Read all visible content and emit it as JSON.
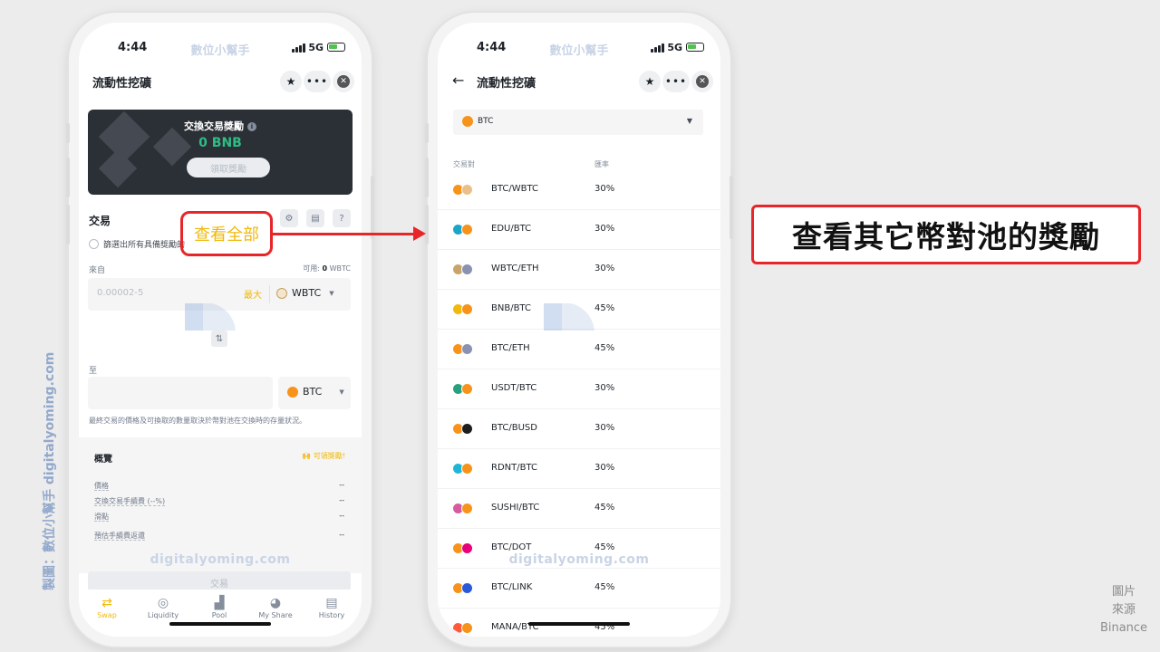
{
  "status": {
    "time": "4:44",
    "watermark": "數位小幫手",
    "network": "5G"
  },
  "left": {
    "nav_title": "流動性挖礦",
    "banner": {
      "title": "交換交易獎勵",
      "amount": "0 BNB",
      "claim": "領取獎勵"
    },
    "section_title": "交易",
    "radio_label": "篩選出所有具備獎勵的",
    "from_label": "來自",
    "available_prefix": "可用:",
    "available_value": "0",
    "available_unit": "WBTC",
    "from_placeholder": "0.00002-5",
    "max_label": "最大",
    "from_token": "WBTC",
    "to_label": "至",
    "to_token": "BTC",
    "note": "最終交易的價格及可換取的數量取決於幣對池在交換時的存量狀況。",
    "overview": {
      "title": "概覽",
      "claim": "可領獎勵!",
      "rows": [
        {
          "k": "價格",
          "v": "--"
        },
        {
          "k": "交換交易手續費 (--%)",
          "v": "--"
        },
        {
          "k": "滑點",
          "v": "--"
        },
        {
          "k": "預估手續費返還",
          "v": "--"
        }
      ]
    },
    "watermark_url": "digitalyoming.com",
    "trade_button": "交易",
    "tabs": [
      "Swap",
      "Liquidity",
      "Pool",
      "My Share",
      "History"
    ]
  },
  "right": {
    "nav_title": "流動性挖礦",
    "selected_token": "BTC",
    "header_pair": "交易對",
    "header_rate": "匯率",
    "watermark_url": "digitalyoming.com",
    "pairs": [
      {
        "pair": "BTC/WBTC",
        "rate": "30%"
      },
      {
        "pair": "EDU/BTC",
        "rate": "30%"
      },
      {
        "pair": "WBTC/ETH",
        "rate": "30%"
      },
      {
        "pair": "BNB/BTC",
        "rate": "45%"
      },
      {
        "pair": "BTC/ETH",
        "rate": "45%"
      },
      {
        "pair": "USDT/BTC",
        "rate": "30%"
      },
      {
        "pair": "BTC/BUSD",
        "rate": "30%"
      },
      {
        "pair": "RDNT/BTC",
        "rate": "30%"
      },
      {
        "pair": "SUSHI/BTC",
        "rate": "45%"
      },
      {
        "pair": "BTC/DOT",
        "rate": "45%"
      },
      {
        "pair": "BTC/LINK",
        "rate": "45%"
      },
      {
        "pair": "MANA/BTC",
        "rate": "45%"
      }
    ]
  },
  "annotations": {
    "highlight": "查看全部",
    "callout": "查看其它幣對池的獎勵",
    "credit": "製圖：數位小幫手 digitalyoming.com",
    "source_line1": "圖片",
    "source_line2": "來源",
    "source_line3": "Binance"
  },
  "colors": {
    "accent": "#f0b90b",
    "annotation_red": "#e8262a",
    "positive": "#2ebd85",
    "btc": "#f7931a"
  }
}
